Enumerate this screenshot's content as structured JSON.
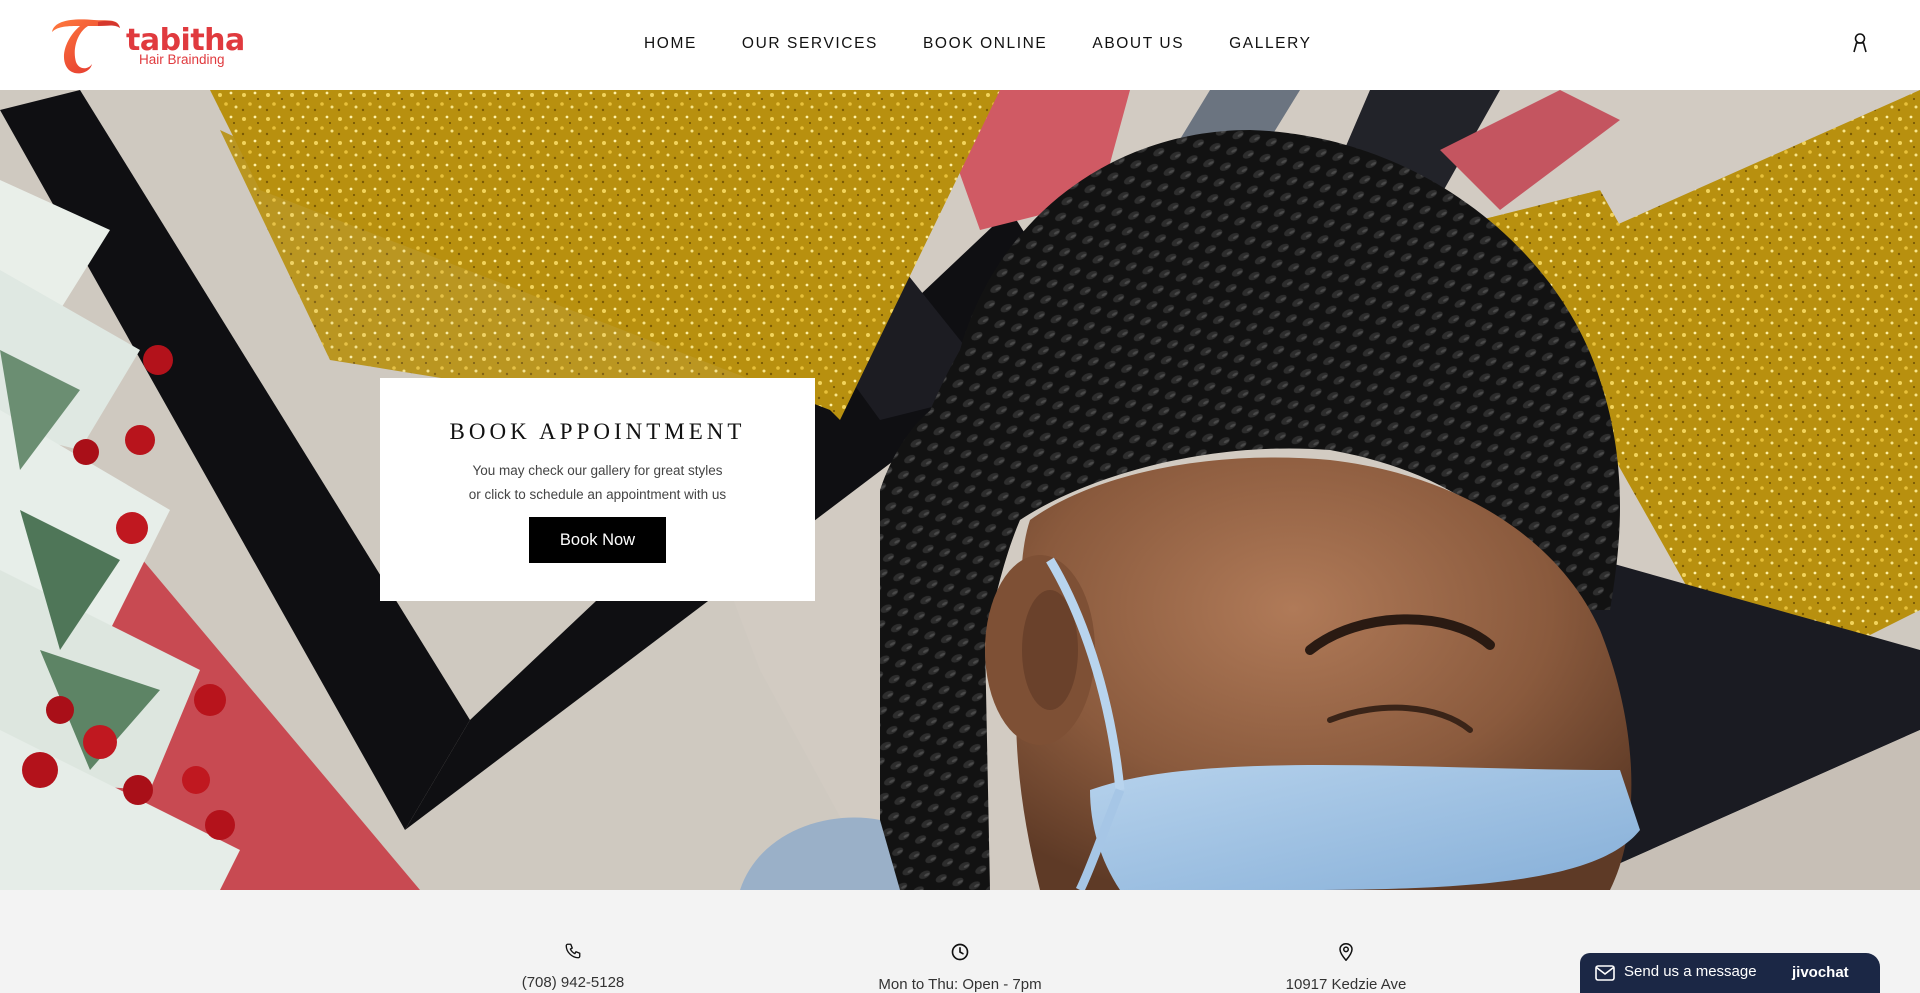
{
  "header": {
    "logo": {
      "word": "tabitha",
      "sub": "Hair Brainding"
    },
    "nav": [
      {
        "label": "HOME"
      },
      {
        "label": "OUR SERVICES"
      },
      {
        "label": "BOOK ONLINE"
      },
      {
        "label": "ABOUT US"
      },
      {
        "label": "GALLERY"
      }
    ],
    "account_icon": "account-icon"
  },
  "hero": {
    "image": "braided-hair-woman-with-mask-against-gold-glitter-wall",
    "card": {
      "title": "BOOK APPOINTMENT",
      "line1": "You may check our gallery for great styles",
      "line2": "or click to schedule an appointment with us",
      "button_label": "Book Now"
    }
  },
  "info": [
    {
      "icon": "phone-icon",
      "text": "(708) 942-5128"
    },
    {
      "icon": "clock-icon",
      "text": "Mon to Thu: Open - 7pm"
    },
    {
      "icon": "location-pin-icon",
      "text": "10917 Kedzie Ave"
    }
  ],
  "chat": {
    "icon": "mail-icon",
    "label": "Send us a message",
    "brand": "jivochat"
  },
  "colors": {
    "brand": "#e03a3e",
    "button": "#000000",
    "chat": "#1b2745",
    "info_bg": "#f3f3f3"
  }
}
